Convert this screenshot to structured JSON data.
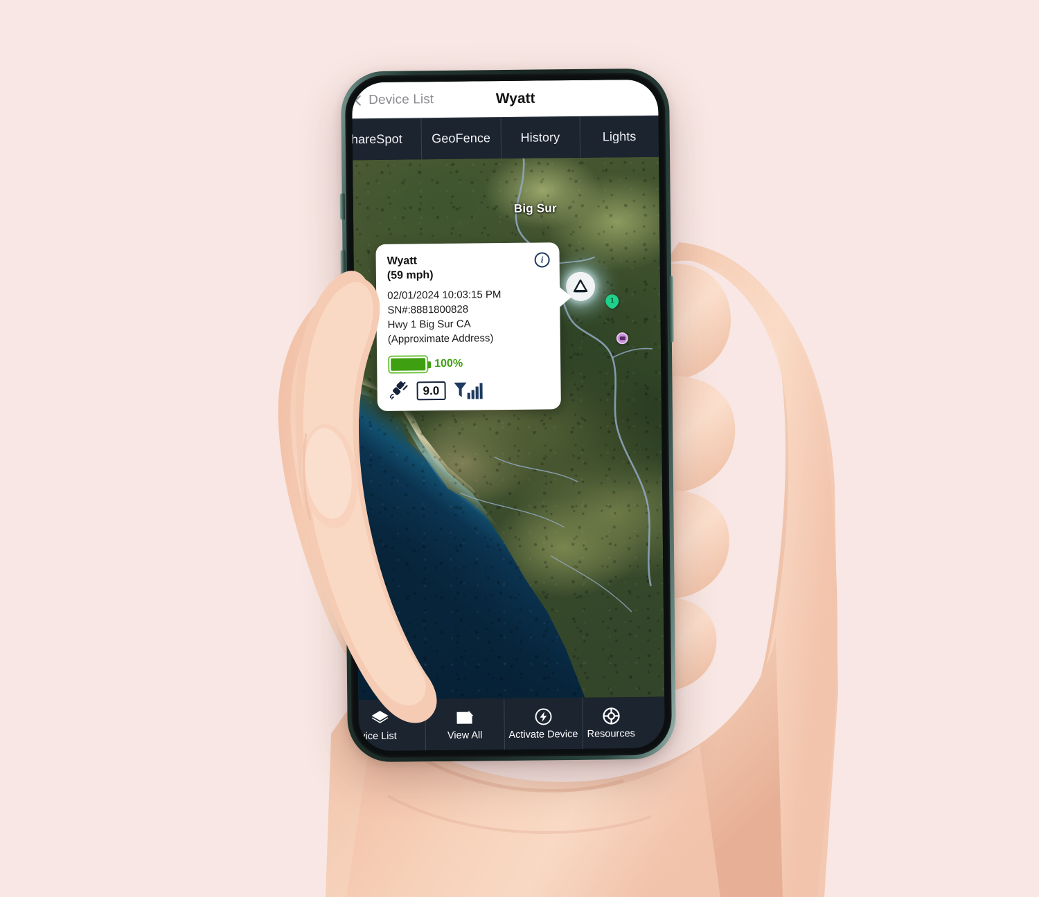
{
  "background_color": "#f8e7e4",
  "device": {
    "frame_color": "#2c4640",
    "name": "smartphone-in-hand"
  },
  "header": {
    "back_label": "Device List",
    "title": "Wyatt",
    "back_icon": "chevron-left-icon"
  },
  "tabs": [
    {
      "label": "ShareSpot",
      "clipped": true
    },
    {
      "label": "GeoFence",
      "clipped": false
    },
    {
      "label": "History",
      "clipped": false
    },
    {
      "label": "Lights",
      "clipped": false
    }
  ],
  "map": {
    "type": "satellite",
    "labels": [
      {
        "text": "Big Sur"
      }
    ],
    "markers": [
      {
        "name": "device-marker",
        "icon": "vehicle-arrow-icon"
      },
      {
        "name": "numbered-pin",
        "label": "1",
        "color": "#1fd18c"
      },
      {
        "name": "poi-pin",
        "color": "#c98fd8"
      }
    ]
  },
  "callout": {
    "device_name": "Wyatt",
    "speed": "(59 mph)",
    "timestamp": "02/01/2024 10:03:15 PM",
    "serial": "SN#:8881800828",
    "address": "Hwy 1 Big Sur CA",
    "address_note": "(Approximate Address)",
    "battery_percent": "100%",
    "battery_color": "#3ea010",
    "gps_value": "9.0",
    "gps_icon": "satellite-icon",
    "signal_icon": "signal-bars-icon",
    "info_icon": "info-circle-icon"
  },
  "bottom_nav": [
    {
      "label": "Device List",
      "icon": "layers-icon",
      "clipped": "left"
    },
    {
      "label": "View All",
      "icon": "folder-icon",
      "clipped": "none"
    },
    {
      "label": "Activate Device",
      "icon": "power-bolt-icon",
      "clipped": "none"
    },
    {
      "label": "Resources",
      "icon": "lifebuoy-icon",
      "clipped": "right"
    }
  ]
}
